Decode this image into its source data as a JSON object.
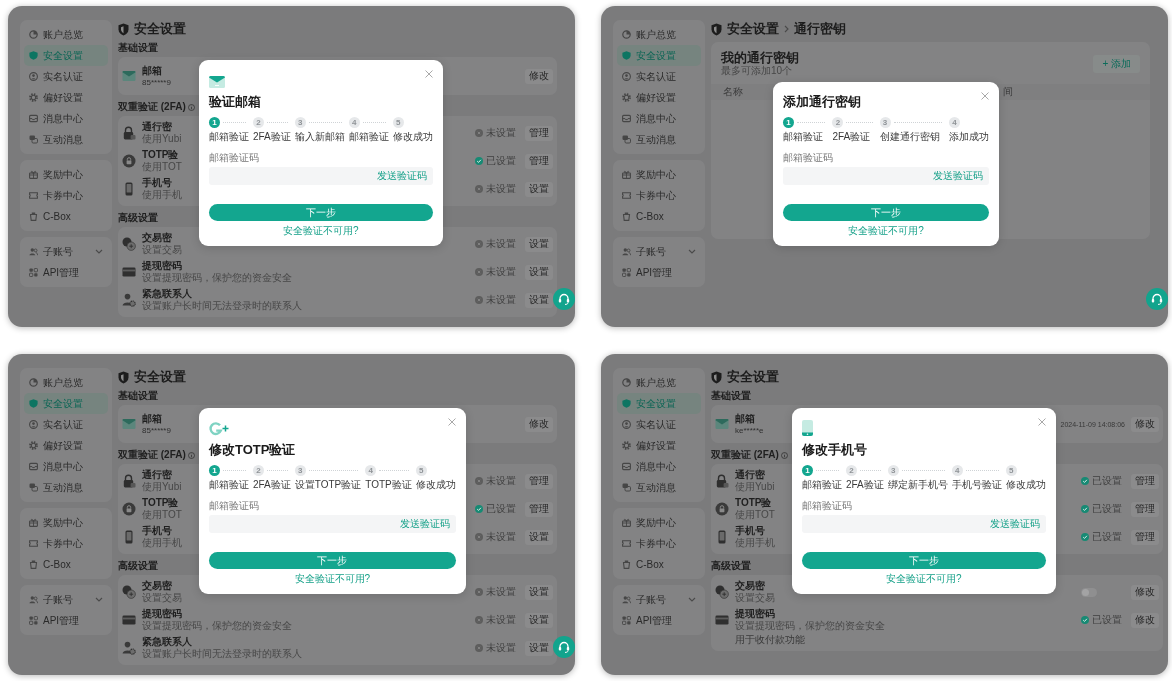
{
  "panels": [
    {
      "sidebar": [
        [
          {
            "label": "账户总览",
            "kind": "link",
            "selected": false
          },
          {
            "label": "安全设置",
            "kind": "link",
            "selected": true
          },
          {
            "label": "实名认证",
            "kind": "link",
            "selected": false
          },
          {
            "label": "偏好设置",
            "kind": "link",
            "selected": false
          },
          {
            "label": "消息中心",
            "kind": "link",
            "selected": false
          },
          {
            "label": "互动消息",
            "kind": "link",
            "selected": false
          }
        ],
        [
          {
            "label": "奖励中心",
            "kind": "link",
            "selected": false
          },
          {
            "label": "卡券中心",
            "kind": "link",
            "selected": false
          },
          {
            "label": "C-Box",
            "kind": "link",
            "selected": false
          }
        ],
        [
          {
            "label": "子账号",
            "kind": "submenu",
            "selected": false
          },
          {
            "label": "API管理",
            "kind": "link",
            "selected": false
          }
        ]
      ],
      "main": {
        "kind": "security",
        "breadcrumb": [
          "安全设置"
        ],
        "sections": [
          {
            "title": "基础设置",
            "rows": [
              {
                "kind": "account",
                "title": "邮箱",
                "detail": "85*****9",
                "button": "修改"
              }
            ]
          },
          {
            "title": "双重验证 (2FA)",
            "info": true,
            "rows": [
              {
                "kind": "status",
                "title": "通行密",
                "detail": "使用Yubi",
                "configured": false,
                "status": "未设置",
                "button": "管理"
              },
              {
                "kind": "status",
                "title": "TOTP验",
                "detail": "使用TOT",
                "configured": true,
                "status": "已设置",
                "button": "管理"
              },
              {
                "kind": "status",
                "title": "手机号",
                "detail": "使用手机",
                "configured": false,
                "status": "未设置",
                "button": "设置"
              }
            ]
          },
          {
            "title": "高级设置",
            "rows": [
              {
                "kind": "status",
                "title": "交易密",
                "detail": "设置交易",
                "configured": false,
                "status": "未设置",
                "button": "设置"
              },
              {
                "kind": "status",
                "title": "提现密码",
                "detail": "设置提现密码，保护您的资金安全",
                "configured": false,
                "status": "未设置",
                "button": "设置"
              },
              {
                "kind": "status",
                "title": "紧急联系人",
                "detail": "设置账户长时间无法登录时的联系人",
                "configured": false,
                "status": "未设置",
                "button": "设置"
              }
            ]
          }
        ]
      },
      "dialog": {
        "kind": "email",
        "title": "验证邮箱",
        "steps": [
          {
            "number": "1",
            "label": "邮箱验证",
            "current": true
          },
          {
            "number": "2",
            "label": "2FA验证",
            "current": false
          },
          {
            "number": "3",
            "label": "输入新邮箱",
            "current": false
          },
          {
            "number": "4",
            "label": "邮箱验证",
            "current": false
          },
          {
            "number": "5",
            "label": "修改成功",
            "current": false
          }
        ],
        "code_field": {
          "label": "邮箱验证码",
          "action": "发送验证码"
        },
        "primary_button": "下一步",
        "help_link": "安全验证不可用?"
      },
      "support_button": true
    },
    {
      "sidebar": [
        [
          {
            "label": "账户总览",
            "kind": "link",
            "selected": false
          },
          {
            "label": "安全设置",
            "kind": "link",
            "selected": true
          },
          {
            "label": "实名认证",
            "kind": "link",
            "selected": false
          },
          {
            "label": "偏好设置",
            "kind": "link",
            "selected": false
          },
          {
            "label": "消息中心",
            "kind": "link",
            "selected": false
          },
          {
            "label": "互动消息",
            "kind": "link",
            "selected": false
          }
        ],
        [
          {
            "label": "奖励中心",
            "kind": "link",
            "selected": false
          },
          {
            "label": "卡券中心",
            "kind": "link",
            "selected": false
          },
          {
            "label": "C-Box",
            "kind": "link",
            "selected": false
          }
        ],
        [
          {
            "label": "子账号",
            "kind": "submenu",
            "selected": false
          },
          {
            "label": "API管理",
            "kind": "link",
            "selected": false
          }
        ]
      ],
      "main": {
        "kind": "passkeys",
        "breadcrumb": [
          "安全设置",
          "通行密钥"
        ],
        "card": {
          "title": "我的通行密钥",
          "subtitle": "最多可添加10个",
          "button": "+ 添加"
        },
        "table": {
          "columns": [
            "名称",
            "间"
          ]
        }
      },
      "dialog": {
        "kind": "passkey",
        "title": "添加通行密钥",
        "steps": [
          {
            "number": "1",
            "label": "邮箱验证",
            "current": true
          },
          {
            "number": "2",
            "label": "2FA验证",
            "current": false
          },
          {
            "number": "3",
            "label": "创建通行密钥",
            "current": false
          },
          {
            "number": "4",
            "label": "添加成功",
            "current": false
          }
        ],
        "code_field": {
          "label": "邮箱验证码",
          "action": "发送验证码"
        },
        "primary_button": "下一步",
        "help_link": "安全验证不可用?"
      },
      "support_button": true
    },
    {
      "sidebar": [
        [
          {
            "label": "账户总览",
            "kind": "link",
            "selected": false
          },
          {
            "label": "安全设置",
            "kind": "link",
            "selected": true
          },
          {
            "label": "实名认证",
            "kind": "link",
            "selected": false
          },
          {
            "label": "偏好设置",
            "kind": "link",
            "selected": false
          },
          {
            "label": "消息中心",
            "kind": "link",
            "selected": false
          },
          {
            "label": "互动消息",
            "kind": "link",
            "selected": false
          }
        ],
        [
          {
            "label": "奖励中心",
            "kind": "link",
            "selected": false
          },
          {
            "label": "卡券中心",
            "kind": "link",
            "selected": false
          },
          {
            "label": "C-Box",
            "kind": "link",
            "selected": false
          }
        ],
        [
          {
            "label": "子账号",
            "kind": "submenu",
            "selected": false
          },
          {
            "label": "API管理",
            "kind": "link",
            "selected": false
          }
        ]
      ],
      "main": {
        "kind": "security",
        "breadcrumb": [
          "安全设置"
        ],
        "sections": [
          {
            "title": "基础设置",
            "rows": [
              {
                "kind": "account",
                "title": "邮箱",
                "detail": "85*****9",
                "button": "修改"
              }
            ]
          },
          {
            "title": "双重验证 (2FA)",
            "info": true,
            "rows": [
              {
                "kind": "status",
                "title": "通行密",
                "detail": "使用Yubi",
                "configured": false,
                "status": "未设置",
                "button": "管理"
              },
              {
                "kind": "status",
                "title": "TOTP验",
                "detail": "使用TOT",
                "configured": true,
                "status": "已设置",
                "button": "管理"
              },
              {
                "kind": "status",
                "title": "手机号",
                "detail": "使用手机",
                "configured": false,
                "status": "未设置",
                "button": "设置"
              }
            ]
          },
          {
            "title": "高级设置",
            "rows": [
              {
                "kind": "status",
                "title": "交易密",
                "detail": "设置交易",
                "configured": false,
                "status": "未设置",
                "button": "设置"
              },
              {
                "kind": "status",
                "title": "提现密码",
                "detail": "设置提现密码，保护您的资金安全",
                "configured": false,
                "status": "未设置",
                "button": "设置"
              },
              {
                "kind": "status",
                "title": "紧急联系人",
                "detail": "设置账户长时间无法登录时的联系人",
                "configured": false,
                "status": "未设置",
                "button": "设置"
              }
            ]
          }
        ]
      },
      "dialog": {
        "kind": "totp",
        "title": "修改TOTP验证",
        "steps": [
          {
            "number": "1",
            "label": "邮箱验证",
            "current": true
          },
          {
            "number": "2",
            "label": "2FA验证",
            "current": false
          },
          {
            "number": "3",
            "label": "设置TOTP验证",
            "current": false
          },
          {
            "number": "4",
            "label": "TOTP验证",
            "current": false
          },
          {
            "number": "5",
            "label": "修改成功",
            "current": false
          }
        ],
        "code_field": {
          "label": "邮箱验证码",
          "action": "发送验证码"
        },
        "primary_button": "下一步",
        "help_link": "安全验证不可用?"
      },
      "support_button": true
    },
    {
      "sidebar": [
        [
          {
            "label": "账户总览",
            "kind": "link",
            "selected": false
          },
          {
            "label": "安全设置",
            "kind": "link",
            "selected": true
          },
          {
            "label": "实名认证",
            "kind": "link",
            "selected": false
          },
          {
            "label": "偏好设置",
            "kind": "link",
            "selected": false
          },
          {
            "label": "消息中心",
            "kind": "link",
            "selected": false
          },
          {
            "label": "互动消息",
            "kind": "link",
            "selected": false
          }
        ],
        [
          {
            "label": "奖励中心",
            "kind": "link",
            "selected": false
          },
          {
            "label": "卡券中心",
            "kind": "link",
            "selected": false
          },
          {
            "label": "C-Box",
            "kind": "link",
            "selected": false
          }
        ],
        [
          {
            "label": "子账号",
            "kind": "submenu",
            "selected": false
          },
          {
            "label": "API管理",
            "kind": "link",
            "selected": false
          }
        ]
      ],
      "main": {
        "kind": "security",
        "breadcrumb": [
          "安全设置"
        ],
        "sections": [
          {
            "title": "基础设置",
            "rows": [
              {
                "kind": "account",
                "title": "邮箱",
                "detail": "ke*****e",
                "date": "2024-11-09 14:08:06",
                "button": "修改"
              }
            ]
          },
          {
            "title": "双重验证 (2FA)",
            "info": true,
            "rows": [
              {
                "kind": "status",
                "title": "通行密",
                "detail": "使用Yubi",
                "configured": true,
                "status": "已设置",
                "button": "管理"
              },
              {
                "kind": "status",
                "title": "TOTP验",
                "detail": "使用TOT",
                "configured": true,
                "status": "已设置",
                "button": "管理"
              },
              {
                "kind": "status",
                "title": "手机号",
                "detail": "使用手机",
                "configured": true,
                "status": "已设置",
                "button": "管理"
              }
            ]
          },
          {
            "title": "高级设置",
            "rows": [
              {
                "kind": "toggle",
                "title": "交易密",
                "detail": "设置交易",
                "on": false,
                "button": "修改"
              },
              {
                "kind": "status",
                "title": "提现密码",
                "detail": "设置提现密码，保护您的资金安全",
                "configured": true,
                "status": "已设置",
                "button": "修改"
              },
              {
                "kind": "note",
                "text": "用于收付款功能"
              }
            ]
          }
        ]
      },
      "dialog": {
        "kind": "phone",
        "title": "修改手机号",
        "steps": [
          {
            "number": "1",
            "label": "邮箱验证",
            "current": true
          },
          {
            "number": "2",
            "label": "2FA验证",
            "current": false
          },
          {
            "number": "3",
            "label": "绑定新手机号",
            "current": false
          },
          {
            "number": "4",
            "label": "手机号验证",
            "current": false
          },
          {
            "number": "5",
            "label": "修改成功",
            "current": false
          }
        ],
        "code_field": {
          "label": "邮箱验证码",
          "action": "发送验证码"
        },
        "primary_button": "下一步",
        "help_link": "安全验证不可用?"
      },
      "support_button": false
    }
  ]
}
